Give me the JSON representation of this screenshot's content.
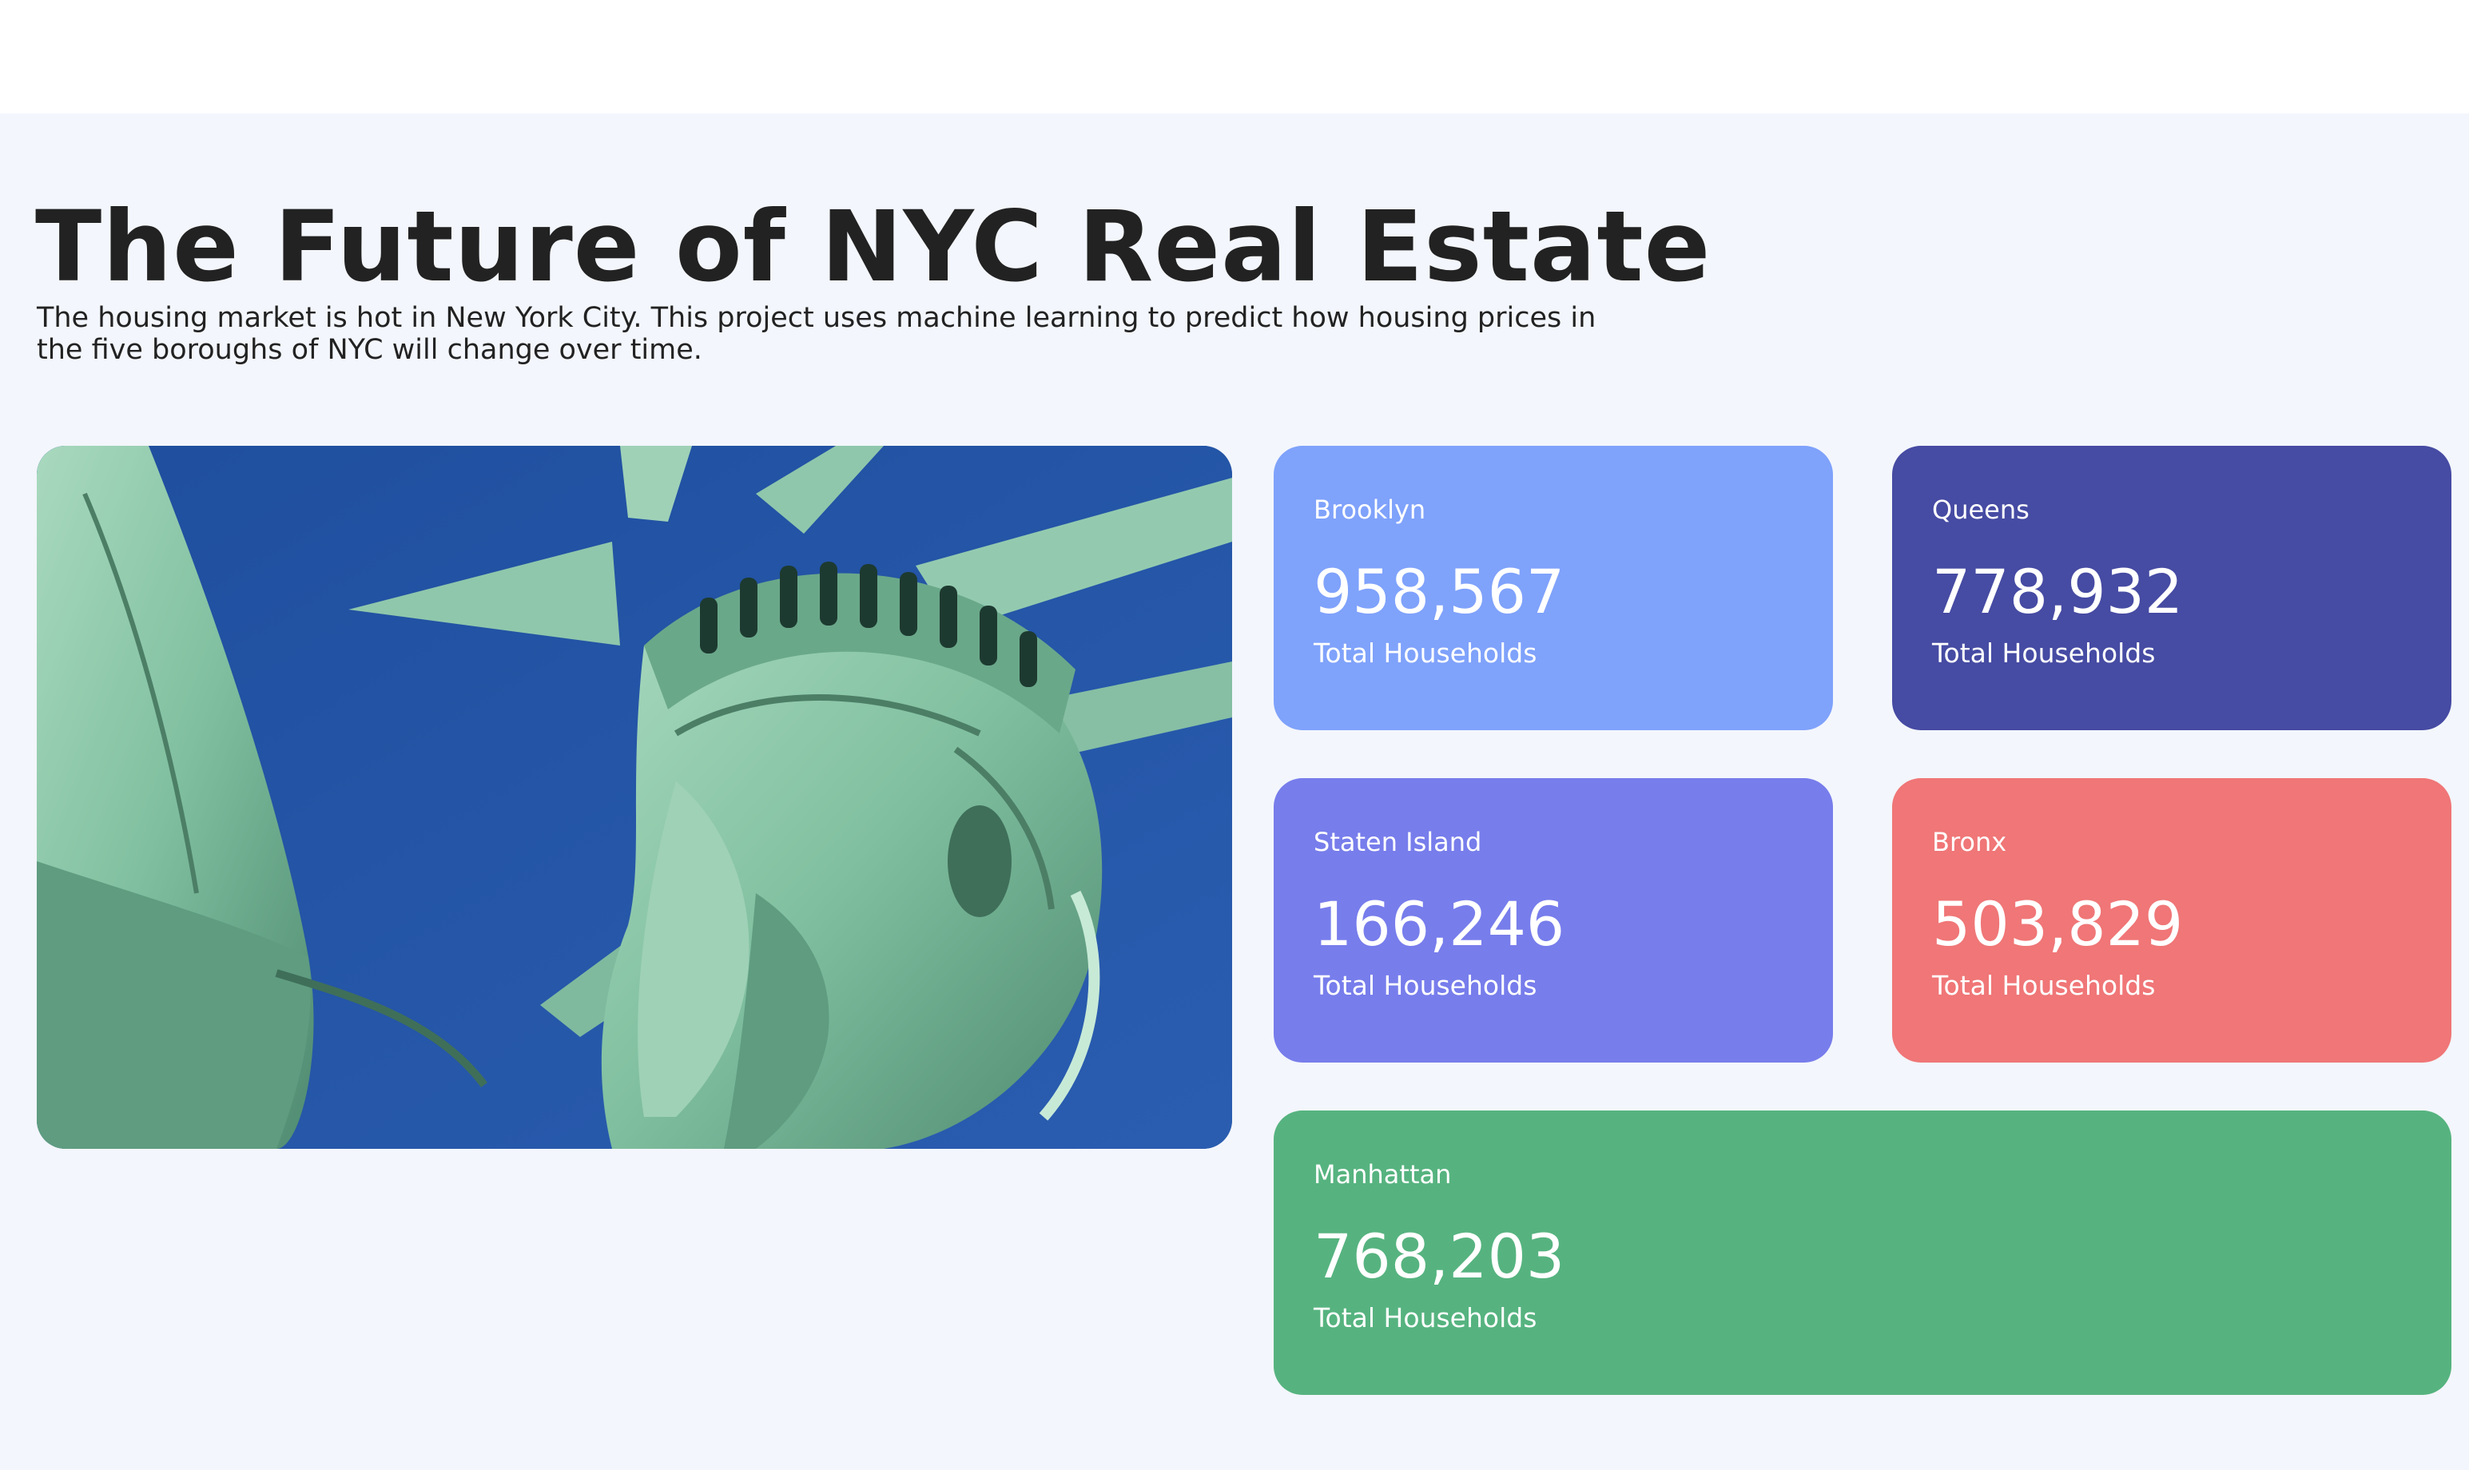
{
  "header": {
    "title": "The Future of NYC Real Estate",
    "description": "The housing market is hot in New York City. This project uses machine learning to predict how housing prices in the five boroughs of NYC will change over time."
  },
  "hero_image": {
    "alt": "Statue of Liberty"
  },
  "boroughs": [
    {
      "name": "Brooklyn",
      "value": "958,567",
      "caption": "Total Households",
      "color": "#7fa2fb"
    },
    {
      "name": "Queens",
      "value": "778,932",
      "caption": "Total Households",
      "color": "#464ba3"
    },
    {
      "name": "Staten Island",
      "value": "166,246",
      "caption": "Total Households",
      "color": "#777deb"
    },
    {
      "name": "Bronx",
      "value": "503,829",
      "caption": "Total Households",
      "color": "#f07677"
    },
    {
      "name": "Manhattan",
      "value": "768,203",
      "caption": "Total Households",
      "color": "#56b37f"
    }
  ],
  "colors": {
    "page_background": "#f3f6fc",
    "top_bar": "#ffffff",
    "heading_text": "#222222"
  }
}
